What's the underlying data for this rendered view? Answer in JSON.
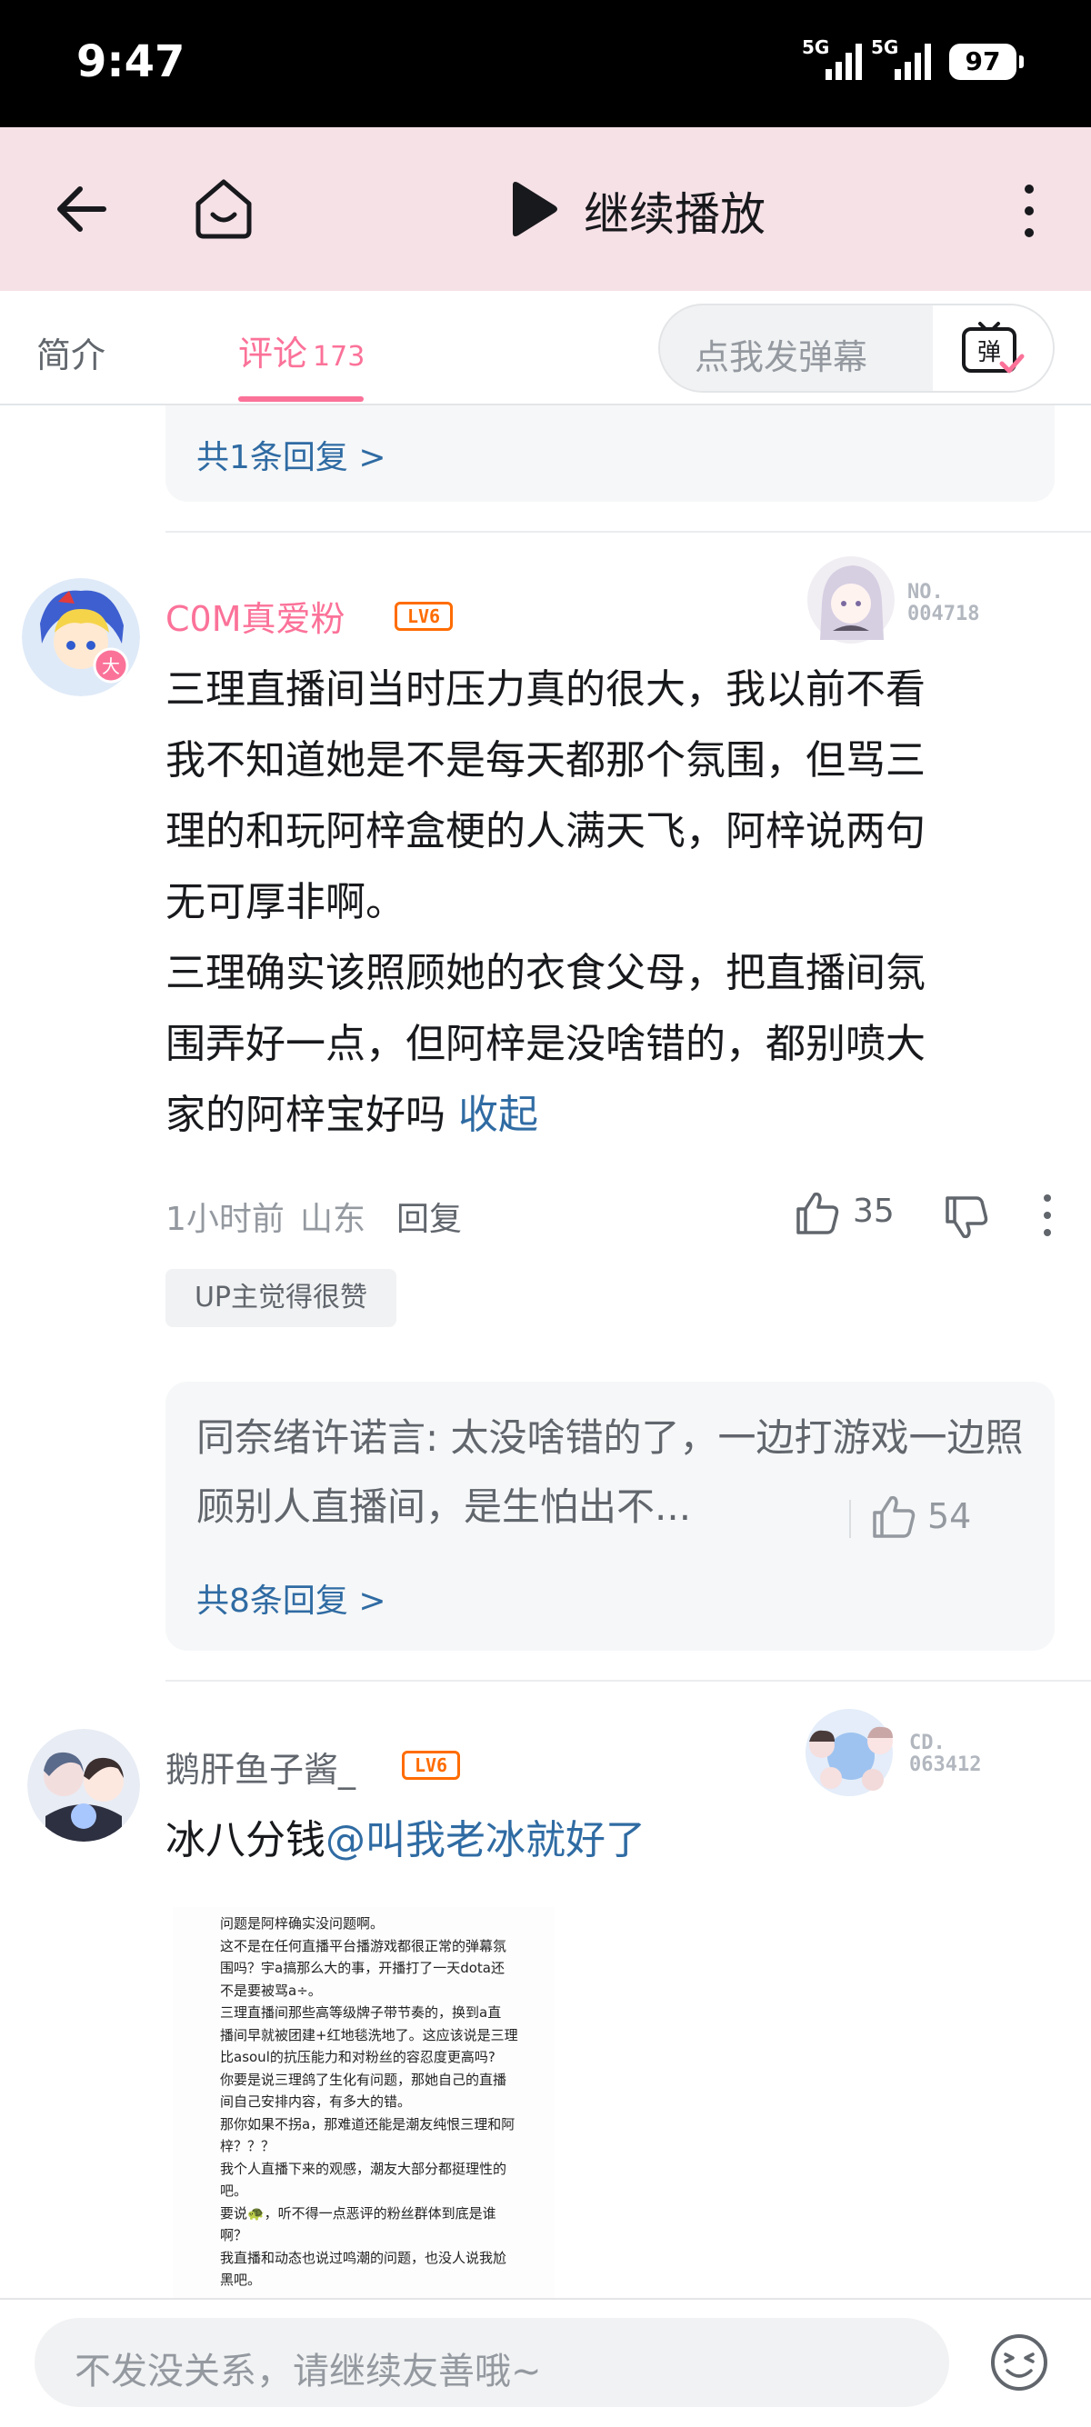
{
  "status_bar": {
    "time": "9:47",
    "signal1": "5G",
    "signal2": "5G",
    "battery": "97"
  },
  "navbar": {
    "title": "继续播放",
    "icons": [
      "back-arrow-icon",
      "home-tv-icon",
      "play-icon",
      "more-vertical-icon"
    ]
  },
  "tabs": {
    "intro": "简介",
    "comments": "评论",
    "comment_count": "173",
    "danmaku_placeholder": "点我发弹幕",
    "danmaku_button": "弹"
  },
  "prev_reply": {
    "link": "共1条回复 >"
  },
  "comment1": {
    "username": "C0M真爱粉",
    "level": "LV6",
    "fan_no": "NO.",
    "fan_no_value": "004718",
    "text_lines": [
      "三理直播间当时压力真的很大，我以前不看",
      "我不知道她是不是每天都那个氛围，但骂三",
      "理的和玩阿梓盒梗的人满天飞，阿梓说两句",
      "无可厚非啊。",
      "三理确实该照顾她的衣食父母，把直播间氛",
      "围弄好一点，但阿梓是没啥错的，都别喷大",
      "家的阿梓宝好吗 "
    ],
    "collapse": "收起",
    "time": "1小时前",
    "location": "山东",
    "reply": "回复",
    "likes": "35",
    "up_tag": "UP主觉得很赞",
    "sub_reply": {
      "text": "同奈绪许诺言: 太没啥错的了，一边打游戏一边照顾别人直播间，是生怕出不...",
      "likes": "54",
      "link": "共8条回复 >"
    }
  },
  "comment2": {
    "username": "鹅肝鱼子酱_",
    "level": "LV6",
    "fan_no": "CD.",
    "fan_no_value": "063412",
    "text": "冰八分钱",
    "mention": "@叫我老冰就好了",
    "image_lines": [
      "问题是阿梓确实没问题啊。",
      "这不是在任何直播平台播游戏都很正常的弹幕氛",
      "围吗？宇a搞那么大的事，开播打了一天dota还",
      "不是要被骂a÷。",
      "三理直播间那些高等级牌子带节奏的，换到a直",
      "播间早就被团建+红地毯洗地了。这应该说是三理",
      "比asoul的抗压能力和对粉丝的容忍度更高吗?",
      "你要是说三理鸽了生化有问题，那她自己的直播",
      "间自己安排内容，有多大的错。",
      "那你如果不拐a，那难道还能是潮友纯恨三理和阿",
      "梓？？？",
      "我个人直播下来的观感，潮友大部分都挺理性的",
      "吧。",
      "要说🐢，听不得一点恶评的粉丝群体到底是谁",
      "啊？",
      "我直播和动态也说过鸣潮的问题，也没人说我尬",
      "黑吧。"
    ]
  },
  "bottom_bar": {
    "placeholder": "不发没关系，请继续友善哦~"
  },
  "colors": {
    "accent": "#fb7299",
    "link": "#2f6ba3",
    "level": "#ff6c00",
    "navbar_bg": "#f6e1e7"
  }
}
